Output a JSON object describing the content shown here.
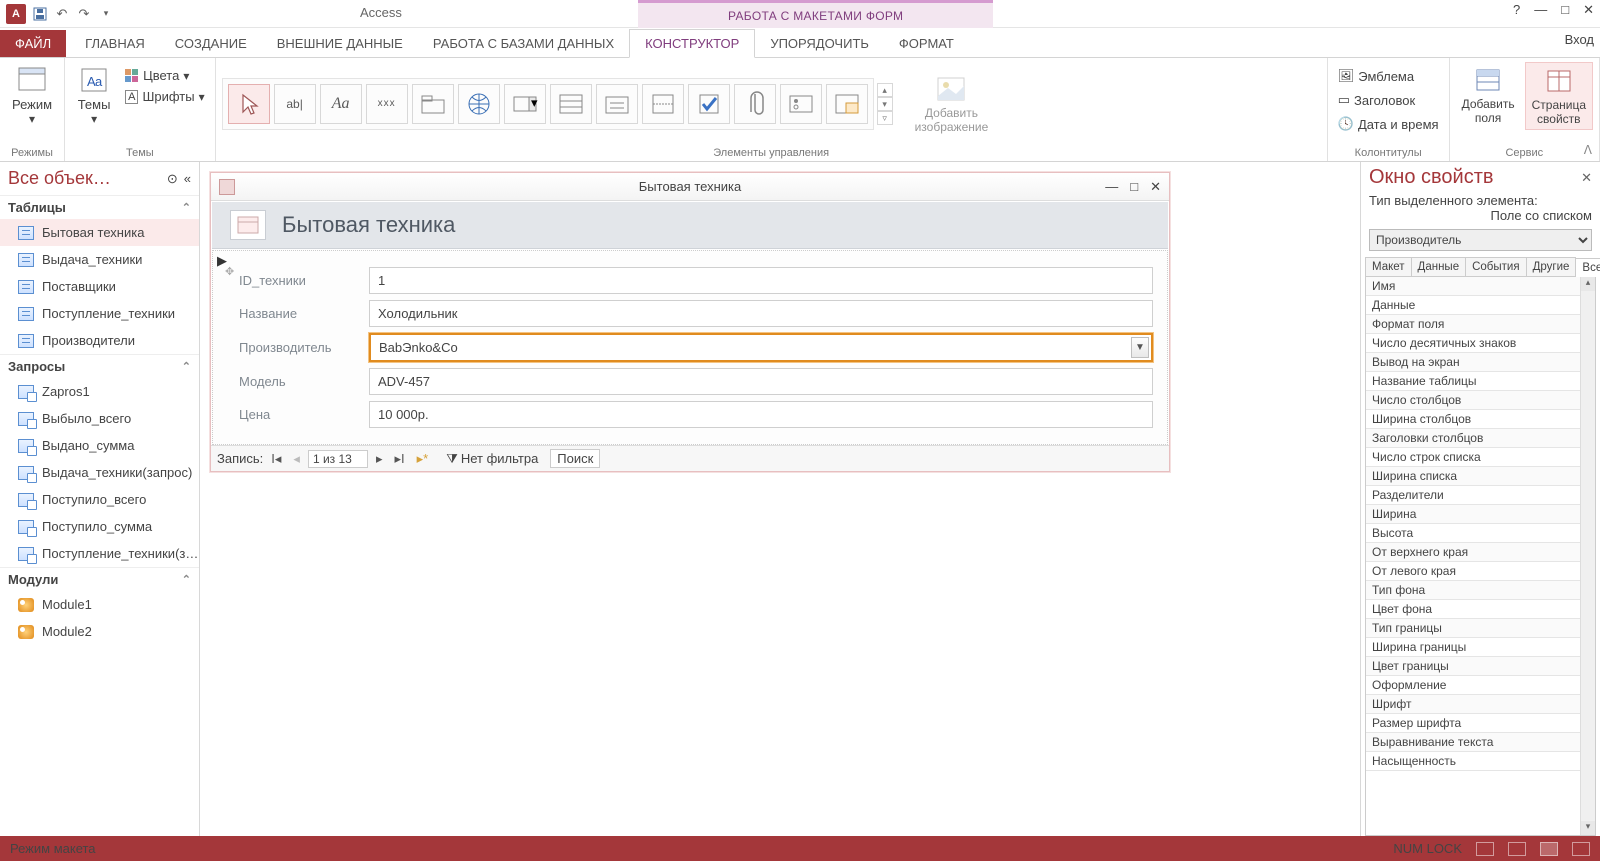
{
  "titlebar": {
    "app": "Access",
    "context": "РАБОТА С МАКЕТАМИ ФОРМ",
    "account": "Вход"
  },
  "tabs": {
    "file": "ФАЙЛ",
    "items": [
      "ГЛАВНАЯ",
      "СОЗДАНИЕ",
      "ВНЕШНИЕ ДАННЫЕ",
      "РАБОТА С БАЗАМИ ДАННЫХ",
      "КОНСТРУКТОР",
      "УПОРЯДОЧИТЬ",
      "ФОРМАТ"
    ],
    "active": "КОНСТРУКТОР"
  },
  "ribbon": {
    "g_modes": {
      "label": "Режимы",
      "mode_btn": "Режим"
    },
    "g_themes": {
      "label": "Темы",
      "themes_btn": "Темы",
      "colors": "Цвета",
      "fonts": "Шрифты"
    },
    "g_controls": {
      "label": "Элементы управления",
      "add_img": "Добавить\nизображение"
    },
    "g_headfoot": {
      "label": "Колонтитулы",
      "logo": "Эмблема",
      "title": "Заголовок",
      "datetime": "Дата и время"
    },
    "g_tools": {
      "label": "Сервис",
      "addfields": "Добавить\nполя",
      "propsheet": "Страница\nсвойств"
    }
  },
  "nav": {
    "title": "Все объек…",
    "groups": [
      {
        "label": "Таблицы",
        "type": "tbl",
        "items": [
          "Бытовая техника",
          "Выдача_техники",
          "Поставщики",
          "Поступление_техники",
          "Производители"
        ],
        "selected": "Бытовая техника"
      },
      {
        "label": "Запросы",
        "type": "qry",
        "items": [
          "Zapros1",
          "Выбыло_всего",
          "Выдано_сумма",
          "Выдача_техники(запрос)",
          "Поступило_всего",
          "Поступило_сумма",
          "Поступление_техники(з…"
        ]
      },
      {
        "label": "Модули",
        "type": "mod",
        "items": [
          "Module1",
          "Module2"
        ]
      }
    ]
  },
  "form": {
    "wintitle": "Бытовая техника",
    "heading": "Бытовая техника",
    "fields": [
      {
        "label": "ID_техники",
        "value": "1"
      },
      {
        "label": "Название",
        "value": "Холодильник"
      },
      {
        "label": "Производитель",
        "value": "BabЭnko&Co",
        "selected": true,
        "combo": true
      },
      {
        "label": "Модель",
        "value": "ADV-457"
      },
      {
        "label": "Цена",
        "value": "10 000р."
      }
    ],
    "recnav": {
      "label": "Запись:",
      "pos": "1 из 13",
      "filter": "Нет фильтра",
      "search": "Поиск"
    }
  },
  "props": {
    "title": "Окно свойств",
    "subtitle_a": "Тип выделенного элемента:",
    "subtitle_b": "Поле со списком",
    "selector": "Производитель",
    "tabs": [
      "Макет",
      "Данные",
      "События",
      "Другие",
      "Все"
    ],
    "active_tab": "Все",
    "rows": [
      "Имя",
      "Данные",
      "Формат поля",
      "Число десятичных знаков",
      "Вывод на экран",
      "Название таблицы",
      "Число столбцов",
      "Ширина столбцов",
      "Заголовки столбцов",
      "Число строк списка",
      "Ширина списка",
      "Разделители",
      "Ширина",
      "Высота",
      "От верхнего края",
      "От левого края",
      "Тип фона",
      "Цвет фона",
      "Тип границы",
      "Ширина границы",
      "Цвет границы",
      "Оформление",
      "Шрифт",
      "Размер шрифта",
      "Выравнивание текста",
      "Насыщенность"
    ]
  },
  "status": {
    "left": "Режим макета",
    "numlock": "NUM LOCK"
  }
}
